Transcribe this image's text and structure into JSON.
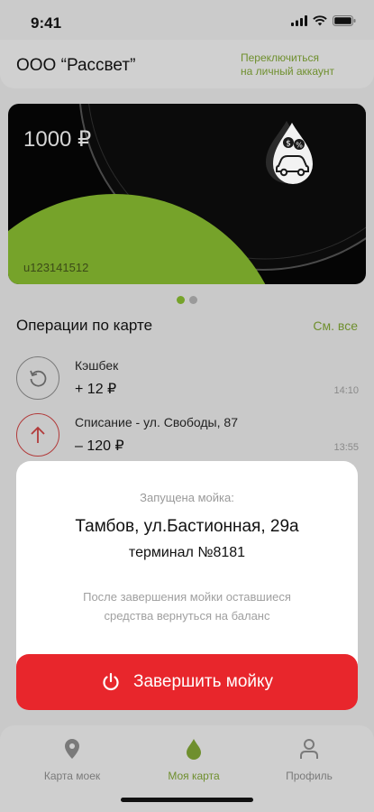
{
  "status_bar": {
    "time": "9:41"
  },
  "header": {
    "company_name": "ООО “Рассвет”",
    "switch_line1": "Переключиться",
    "switch_line2": "на личный аккаунт"
  },
  "card": {
    "balance": "1000 ₽",
    "number": "u123141512",
    "pager_active_index": 0,
    "pager_count": 2
  },
  "operations": {
    "title": "Операции по карте",
    "see_all": "См. все",
    "items": [
      {
        "title": "Кэшбек",
        "amount": "+ 12 ₽",
        "time": "14:10",
        "icon": "refresh-icon"
      },
      {
        "title": "Списание - ул. Свободы, 87",
        "amount": "– 120 ₽",
        "time": "13:55",
        "icon": "arrow-up-icon"
      }
    ]
  },
  "modal": {
    "label": "Запущена мойка:",
    "address": "Тамбов, ул.Бастионная, 29а",
    "terminal": "терминал №8181",
    "note_line1": "После завершения мойки оставшиеся",
    "note_line2": "средства вернуться на баланс",
    "button_label": "Завершить мойку"
  },
  "tabs": [
    {
      "label": "Карта моек",
      "icon": "map-pin-icon",
      "active": false
    },
    {
      "label": "Моя карта",
      "icon": "drop-icon",
      "active": true
    },
    {
      "label": "Профиль",
      "icon": "profile-icon",
      "active": false
    }
  ],
  "colors": {
    "accent_green": "#6f8f2e",
    "card_green": "#76a32a",
    "danger_red": "#e8262c",
    "card_black": "#050505"
  }
}
